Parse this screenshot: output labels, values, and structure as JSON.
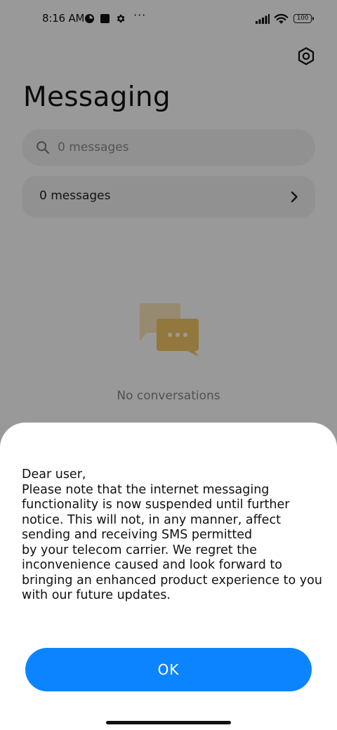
{
  "status_bar": {
    "time": "8:16 AM",
    "more": "···",
    "battery": "100",
    "icons": [
      "notification-app-icon",
      "notification-square-icon",
      "gear-icon",
      "signal-icon",
      "wifi-icon",
      "battery-icon"
    ]
  },
  "header": {
    "title": "Messaging",
    "settings_icon": "settings-icon"
  },
  "search": {
    "placeholder": "0 messages",
    "icon": "search-icon"
  },
  "messages_row": {
    "label": "0 messages",
    "icon": "chevron-right-icon"
  },
  "empty_state": {
    "text": "No conversations",
    "icon": "chat-bubbles-icon"
  },
  "dialog": {
    "message": "Dear user,\nPlease note that the internet messaging functionality is now suspended until further notice. This will not, in any manner, affect sending and receiving SMS permitted\nby your telecom carrier. We regret the inconvenience caused and look forward to bringing an enhanced product experience to you with our future updates.",
    "ok_label": "OK"
  },
  "colors": {
    "accent": "#0d84ff",
    "scrim": "rgba(0,0,0,0.40)",
    "card": "#f2f2f2",
    "illustration": "#f3c867"
  }
}
